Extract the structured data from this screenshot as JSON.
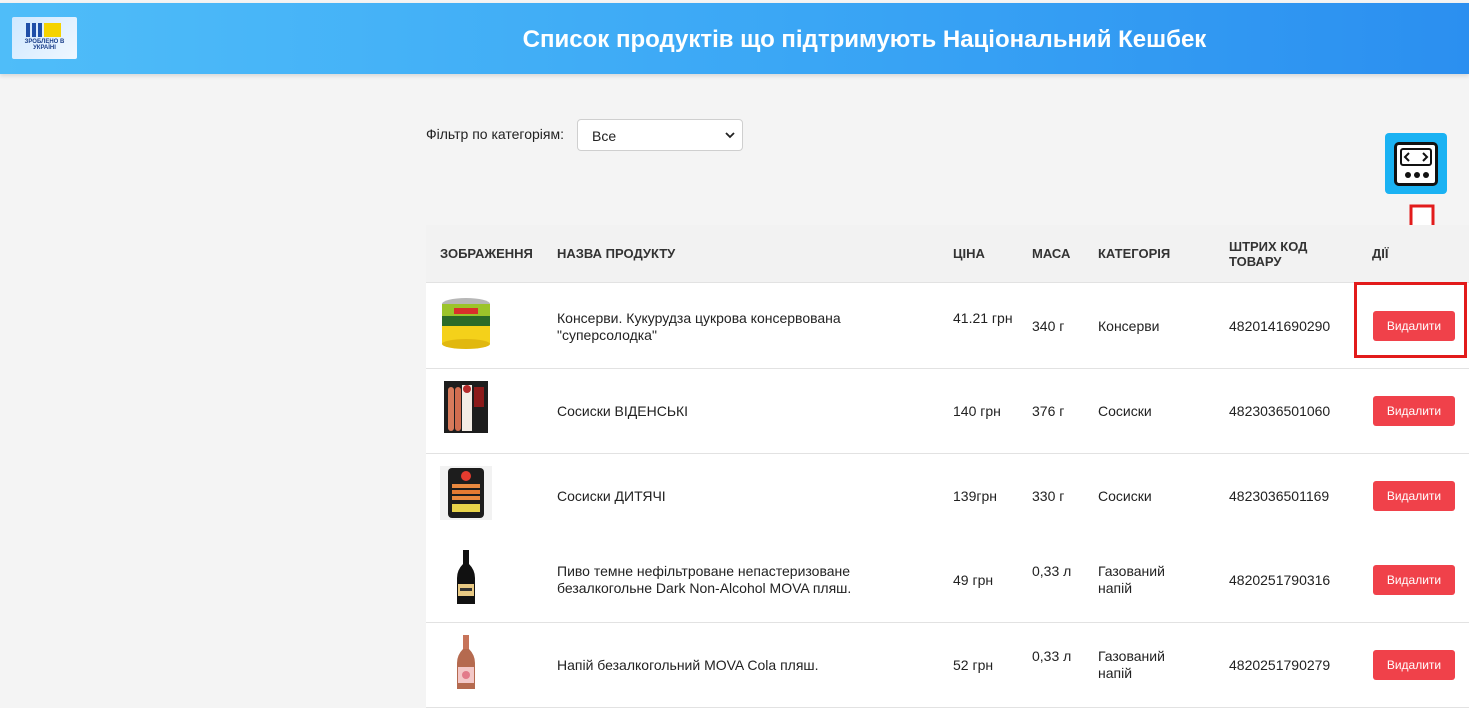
{
  "header": {
    "logo_text": "ЗРОБЛЕНО В УКРАЇНІ",
    "title": "Список продуктів що підтримують Національний Кешбек"
  },
  "filter": {
    "label": "Фільтр по категоріям:",
    "selected": "Все"
  },
  "table": {
    "columns": [
      "Зображення",
      "Назва продукту",
      "Ціна",
      "Маса",
      "Категорія",
      "Штрих код товару",
      "Дії"
    ],
    "rows": [
      {
        "name": "Консерви. Кукурудза цукрова консервована \"суперсолодка\"",
        "price": "41.21 грн",
        "mass": "340 г",
        "category": "Консерви",
        "barcode": "4820141690290",
        "action": "Видалити",
        "image": "corn-can-image"
      },
      {
        "name": "Сосиски ВІДЕНСЬКІ",
        "price": "140 грн",
        "mass": "376 г",
        "category": "Сосиски",
        "barcode": "4823036501060",
        "action": "Видалити",
        "image": "sausage-pack-image"
      },
      {
        "name": "Сосиски ДИТЯЧІ",
        "price": "139грн",
        "mass": "330 г",
        "category": "Сосиски",
        "barcode": "4823036501169",
        "action": "Видалити",
        "image": "kids-sausage-pack-image"
      },
      {
        "name": "Пиво темне нефільтроване непастеризоване безалкогольне Dark Non-Alcohol MOVA пляш.",
        "price": "49 грн",
        "mass": "0,33 л",
        "category": "Газований напій",
        "barcode": "4820251790316",
        "action": "Видалити",
        "image": "dark-beer-bottle-image"
      },
      {
        "name": "Напій безалкогольний MOVA Cola пляш.",
        "price": "52 грн",
        "mass": "0,33 л",
        "category": "Газований напій",
        "barcode": "4820251790279",
        "action": "Видалити",
        "image": "cola-bottle-image"
      }
    ]
  },
  "colors": {
    "header_start": "#4fbdf9",
    "header_end": "#2b8ff0",
    "delete_button": "#f0414a",
    "annotation_red": "#e21b1b",
    "device_icon_bg": "#1ab2f3"
  },
  "icons": [
    "device-screen-icon",
    "chevron-down-icon",
    "down-arrow-annotation"
  ]
}
